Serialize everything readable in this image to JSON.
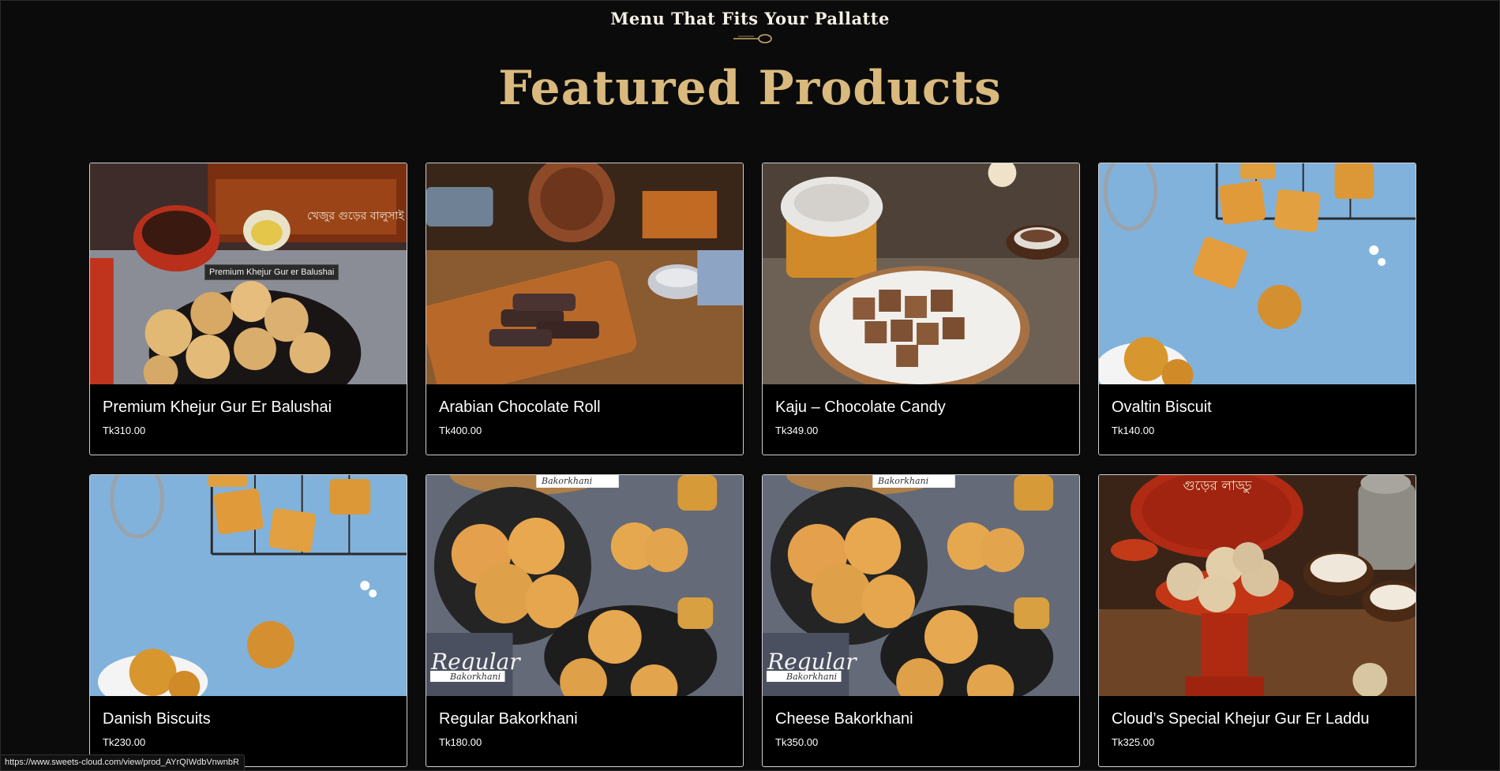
{
  "header": {
    "tagline": "Menu That Fits Your Pallatte",
    "title": "Featured Products"
  },
  "products": [
    {
      "name": "Premium Khejur Gur Er Balushai",
      "price": "Tk310.00",
      "photo_text": "খেজুর গুড়ের বালুসাই"
    },
    {
      "name": "Arabian Chocolate Roll",
      "price": "Tk400.00"
    },
    {
      "name": "Kaju – Chocolate Candy",
      "price": "Tk349.00"
    },
    {
      "name": "Ovaltin Biscuit",
      "price": "Tk140.00"
    },
    {
      "name": "Danish Biscuits",
      "price": "Tk230.00"
    },
    {
      "name": "Regular Bakorkhani",
      "price": "Tk180.00",
      "photo_text": "Regular",
      "photo_sub": "Bakorkhani",
      "photo_top": "Bakorkhani"
    },
    {
      "name": "Cheese Bakorkhani",
      "price": "Tk350.00",
      "photo_text": "Regular",
      "photo_sub": "Bakorkhani",
      "photo_top": "Bakorkhani"
    },
    {
      "name": "Cloud’s Special Khejur Gur Er Laddu",
      "price": "Tk325.00",
      "photo_text": "গুড়ের লাড্ডু"
    }
  ],
  "tooltip": "Premium Khejur Gur er Balushai",
  "status_bar": {
    "url": "https://www.sweets-cloud.com/view/prod_AYrQIWdbVnwnbR"
  },
  "colors": {
    "background": "#0b0b0b",
    "title_gold": "#d9b97d",
    "card_border": "#cfcfcf"
  }
}
